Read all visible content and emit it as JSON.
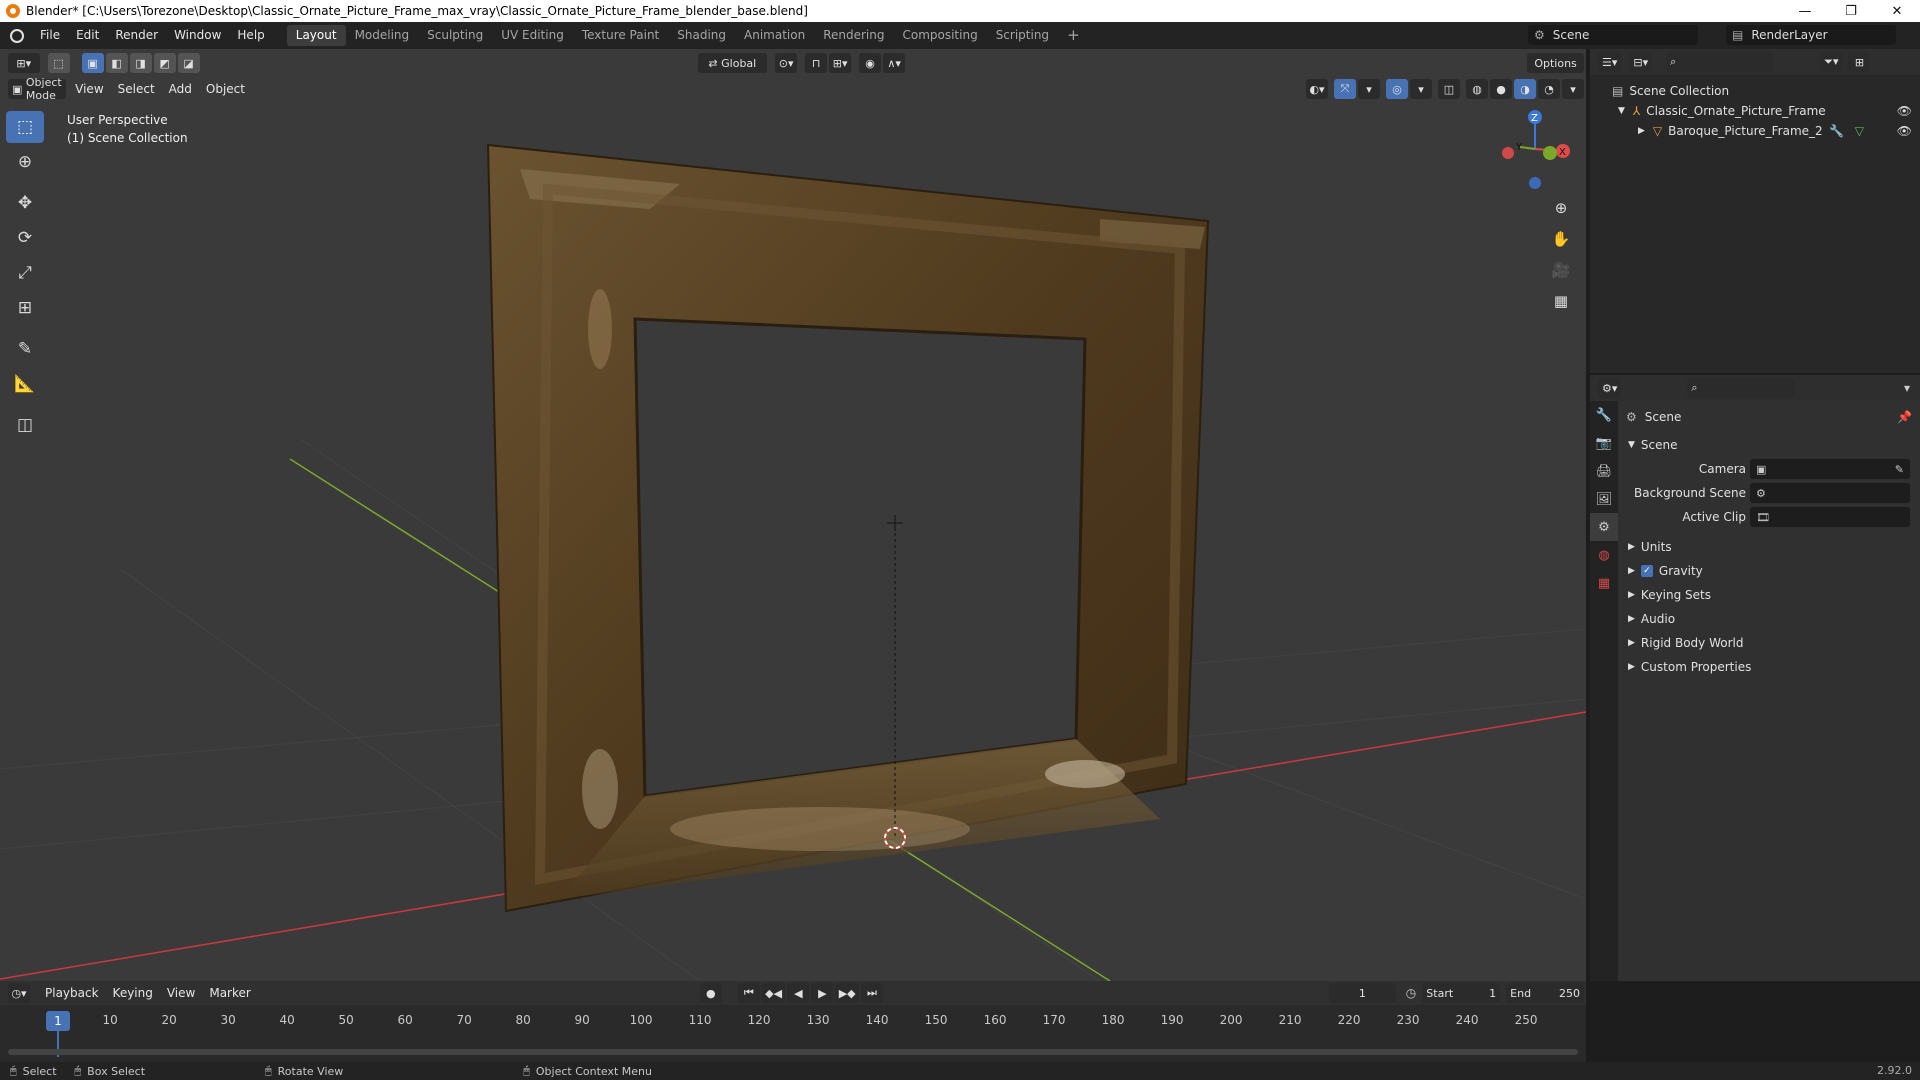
{
  "window": {
    "title": "Blender* [C:\\Users\\Torezone\\Desktop\\Classic_Ornate_Picture_Frame_max_vray\\Classic_Ornate_Picture_Frame_blender_base.blend]",
    "buttons": [
      "—",
      "❐",
      "✕"
    ]
  },
  "menu": [
    "File",
    "Edit",
    "Render",
    "Window",
    "Help"
  ],
  "workspaces": [
    "Layout",
    "Modeling",
    "Sculpting",
    "UV Editing",
    "Texture Paint",
    "Shading",
    "Animation",
    "Rendering",
    "Compositing",
    "Scripting"
  ],
  "active_workspace": "Layout",
  "scene_selector": "Scene",
  "render_layer": "RenderLayer",
  "viewport": {
    "mode": "Object Mode",
    "menus": [
      "View",
      "Select",
      "Add",
      "Object"
    ],
    "transform_orientation": "Global",
    "options_label": "Options",
    "perspective_label": "User Perspective",
    "collection_label": "(1) Scene Collection",
    "gizmo": {
      "x": "X",
      "y": "Y",
      "z": "Z"
    }
  },
  "outliner": {
    "root": "Scene Collection",
    "items": [
      {
        "label": "Classic_Ornate_Picture_Frame",
        "icon": "collection-icon"
      },
      {
        "label": "Baroque_Picture_Frame_2",
        "icon": "mesh-icon"
      }
    ]
  },
  "properties": {
    "context_title": "Scene",
    "panel_title": "Scene",
    "fields": [
      {
        "label": "Camera",
        "value": ""
      },
      {
        "label": "Background Scene",
        "value": ""
      },
      {
        "label": "Active Clip",
        "value": ""
      }
    ],
    "subpanels": [
      "Units",
      "Gravity",
      "Keying Sets",
      "Audio",
      "Rigid Body World",
      "Custom Properties"
    ],
    "gravity_checked": true
  },
  "timeline": {
    "menus": [
      "Playback",
      "Keying",
      "View",
      "Marker"
    ],
    "current_frame": "1",
    "start_label": "Start",
    "start_value": "1",
    "end_label": "End",
    "end_value": "250",
    "ticks": [
      "10",
      "20",
      "30",
      "40",
      "50",
      "60",
      "70",
      "80",
      "90",
      "100",
      "110",
      "120",
      "130",
      "140",
      "150",
      "160",
      "170",
      "180",
      "190",
      "200",
      "210",
      "220",
      "230",
      "240",
      "250"
    ]
  },
  "statusbar": {
    "select": "Select",
    "box_select": "Box Select",
    "rotate": "Rotate View",
    "context_menu": "Object Context Menu",
    "version": "2.92.0"
  },
  "colors": {
    "accent": "#4772b3",
    "viewport_bg": "#3a3a3a",
    "frame_wood": "#5a4424",
    "axis_x": "#c9393f",
    "axis_y": "#7aa82a"
  }
}
